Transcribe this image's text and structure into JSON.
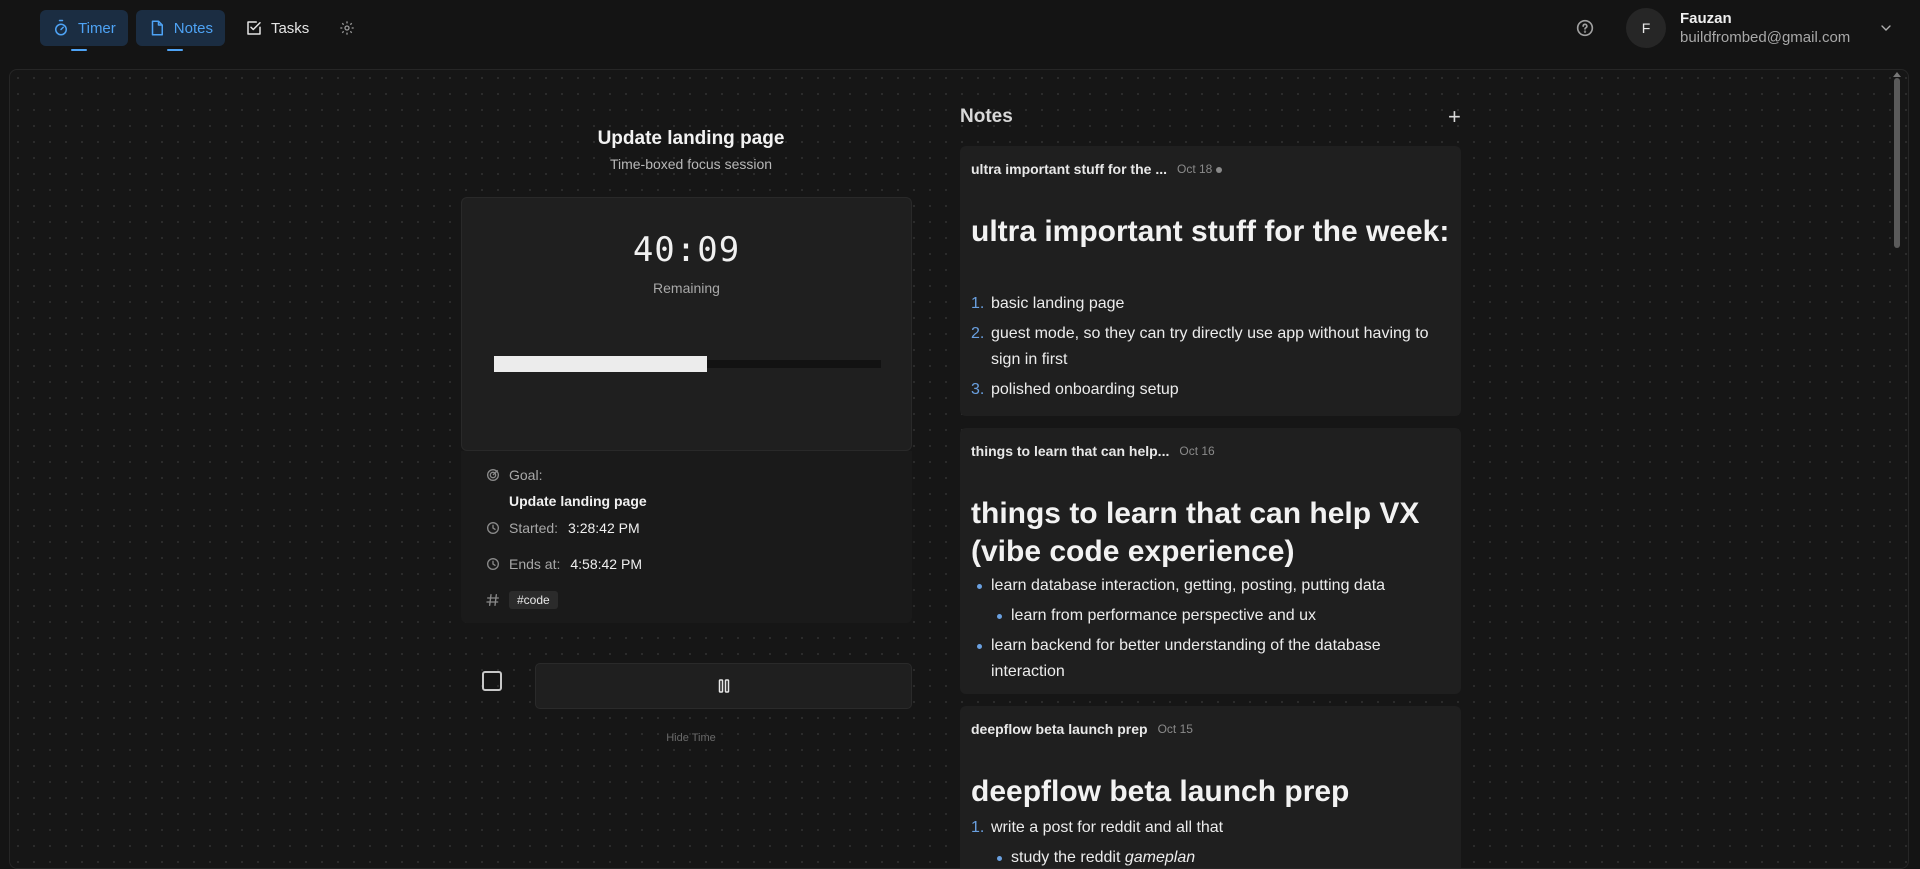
{
  "nav": {
    "timer": "Timer",
    "notes": "Notes",
    "tasks": "Tasks"
  },
  "user": {
    "initial": "F",
    "name": "Fauzan",
    "email": "buildfrombed@gmail.com"
  },
  "session": {
    "title": "Update landing page",
    "subtitle": "Time-boxed focus session",
    "time": "40:09",
    "remaining_label": "Remaining",
    "progress_fraction": 0.55,
    "goal_label": "Goal:",
    "goal_value": "Update landing page",
    "started_label": "Started:",
    "started_value": "3:28:42 PM",
    "ends_label": "Ends at:",
    "ends_value": "4:58:42 PM",
    "tag": "#code",
    "hide_time": "Hide Time"
  },
  "notes": {
    "title": "Notes",
    "add": "+",
    "items": [
      {
        "title": "ultra important stuff for the ...",
        "date": "Oct 18",
        "heading": "ultra important stuff for the week:",
        "list": [
          "basic landing page",
          "guest mode, so they can try directly use app without having to sign in first",
          "polished onboarding setup"
        ]
      },
      {
        "title": "things to learn that can help...",
        "date": "Oct 16",
        "heading": "things to learn that can help VX (vibe code experience)",
        "list": [
          "learn database interaction, getting, posting, putting data",
          "learn from performance perspective and ux",
          "learn backend for better understanding of the database interaction"
        ]
      },
      {
        "title": "deepflow beta launch prep",
        "date": "Oct 15",
        "heading": "deepflow beta launch prep",
        "list": [
          "write a post for reddit and all that",
          "study the reddit",
          "gameplan"
        ]
      }
    ]
  }
}
